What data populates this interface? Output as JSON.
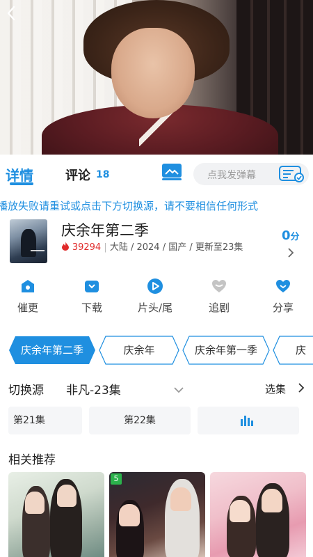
{
  "header": {
    "back_icon": "chevron-left-icon"
  },
  "tabs": {
    "detail_label": "详情",
    "comment_label": "评论",
    "comment_count": "18"
  },
  "danmu": {
    "placeholder": "点我发弹幕"
  },
  "notice": "播放失败请重试或点击下方切换源，请不要相信任何形式",
  "show": {
    "title": "庆余年第二季",
    "hot_count": "39294",
    "meta_rest": "大陆 / 2024 / 国产 / 更新至23集",
    "score": "0",
    "score_unit": "分"
  },
  "actions": [
    {
      "label": "催更",
      "icon": "home-icon"
    },
    {
      "label": "下载",
      "icon": "download-icon"
    },
    {
      "label": "片头/尾",
      "icon": "play-icon"
    },
    {
      "label": "追剧",
      "icon": "heart-icon"
    },
    {
      "label": "分享",
      "icon": "share-icon"
    }
  ],
  "seasons": [
    {
      "label": "庆余年第二季",
      "selected": true
    },
    {
      "label": "庆余年",
      "selected": false
    },
    {
      "label": "庆余年第一季",
      "selected": false
    },
    {
      "label": "庆",
      "selected": false
    }
  ],
  "source": {
    "label": "切换源",
    "value": "非凡-23集",
    "select_episodes": "选集"
  },
  "episodes": [
    "第21集",
    "第22集"
  ],
  "related": {
    "title": "相关推荐",
    "badge": "5"
  },
  "colors": {
    "accent": "#1f8fe0",
    "hot": "#e02b2b"
  }
}
